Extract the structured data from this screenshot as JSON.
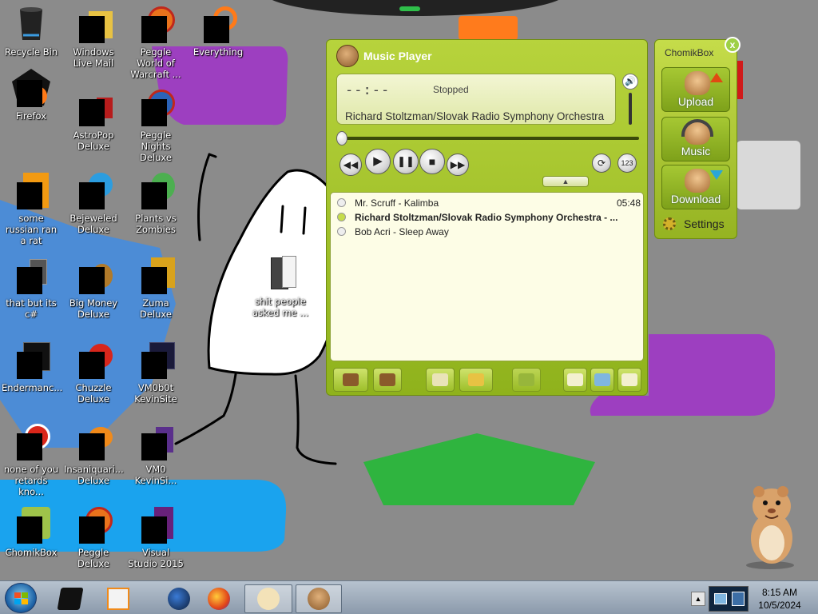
{
  "desktop_icons": [
    {
      "label": "Recycle Bin"
    },
    {
      "label": "Windows Live Mail"
    },
    {
      "label": "Peggle World of Warcraft ..."
    },
    {
      "label": "Everything"
    },
    {
      "label": "Firefox"
    },
    {
      "label": "AstroPop Deluxe"
    },
    {
      "label": "Peggle Nights Deluxe"
    },
    {
      "label": "some russian ran a rat"
    },
    {
      "label": "Bejeweled Deluxe"
    },
    {
      "label": "Plants vs Zombies"
    },
    {
      "label": "that but its c#"
    },
    {
      "label": "Big Money Deluxe"
    },
    {
      "label": "Zuma Deluxe"
    },
    {
      "label": "Endermanc..."
    },
    {
      "label": "Chuzzle Deluxe"
    },
    {
      "label": "VM0b0t KevinSite"
    },
    {
      "label": "none of you retards kno..."
    },
    {
      "label": "Insaniquari... Deluxe"
    },
    {
      "label": "VM0 KevinSi..."
    },
    {
      "label": "ChomikBox"
    },
    {
      "label": "Peggle Deluxe"
    },
    {
      "label": "Visual Studio 2015"
    },
    {
      "label": "shit people asked me ..."
    }
  ],
  "music_player": {
    "title": "Music Player",
    "time": "--:--",
    "status": "Stopped",
    "track": "Richard Stoltzman/Slovak Radio Symphony Orchestra",
    "playlist": [
      {
        "title": "Mr. Scruff - Kalimba",
        "duration": "05:48",
        "active": false
      },
      {
        "title": "Richard Stoltzman/Slovak Radio Symphony Orchestra - ...",
        "duration": "",
        "active": true
      },
      {
        "title": "Bob Acri - Sleep Away",
        "duration": "",
        "active": false
      }
    ]
  },
  "chomikbox": {
    "title": "ChomikBox",
    "close_label": "x",
    "buttons": [
      {
        "label": "Upload"
      },
      {
        "label": "Music"
      },
      {
        "label": "Download"
      }
    ],
    "settings_label": "Settings"
  },
  "taskbar": {
    "time": "8:15 AM",
    "date": "10/5/2024"
  }
}
